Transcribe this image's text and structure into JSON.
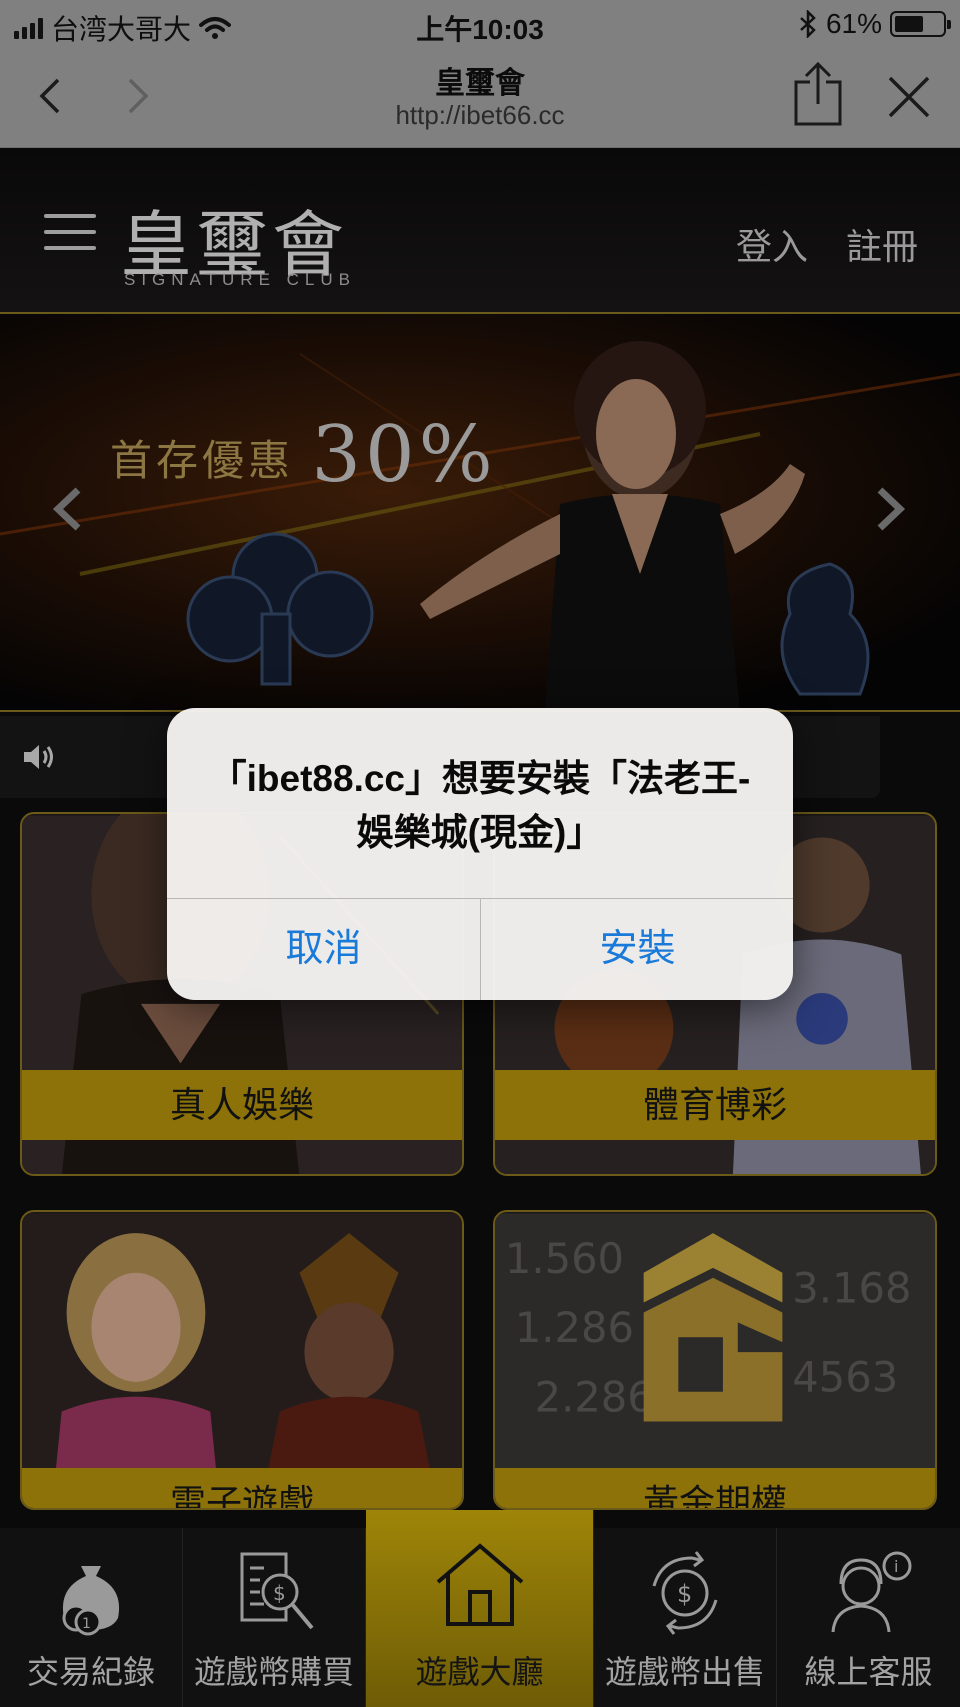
{
  "status_bar": {
    "carrier": "台湾大哥大",
    "time": "上午10:03",
    "battery": "61%",
    "battery_level": 0.61
  },
  "browser": {
    "title": "皇璽會",
    "url": "http://ibet66.cc"
  },
  "header": {
    "logo": "皇璽會",
    "logo_subtitle": "SIGNATURE CLUB",
    "login": "登入",
    "register": "註冊"
  },
  "banner": {
    "promo_text": "首存優惠",
    "promo_percent": "30%"
  },
  "tiles": [
    {
      "label": "真人娛樂"
    },
    {
      "label": "體育博彩"
    },
    {
      "label": "電子遊戲"
    },
    {
      "label": "黃金期權"
    }
  ],
  "bottom_nav": [
    {
      "label": "交易紀錄",
      "icon": "money-bag-icon"
    },
    {
      "label": "遊戲幣購買",
      "icon": "invoice-search-icon"
    },
    {
      "label": "遊戲大廳",
      "icon": "home-icon"
    },
    {
      "label": "遊戲幣出售",
      "icon": "dollar-exchange-icon"
    },
    {
      "label": "線上客服",
      "icon": "customer-service-icon"
    }
  ],
  "dialog": {
    "message": "「ibet88.cc」想要安裝「法老王-娛樂城(現金)」",
    "cancel": "取消",
    "install": "安裝"
  },
  "colors": {
    "gold": "#8c7208",
    "dialog_button": "#1a7ad9",
    "status_bar_bg": "#808080"
  }
}
